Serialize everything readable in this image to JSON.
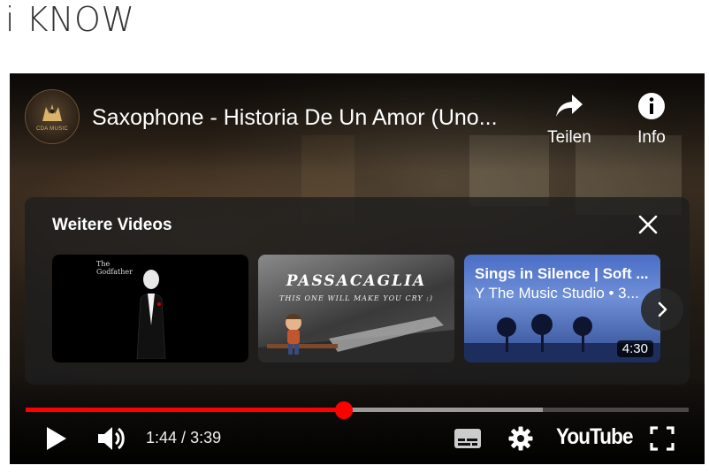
{
  "page": {
    "heading": "i KNOW"
  },
  "player": {
    "channel_logo_text": "CDA MUSIC",
    "title": "Saxophone - Historia De Un Amor (Uno...",
    "actions": [
      {
        "label": "Teilen",
        "icon": "share-icon"
      },
      {
        "label": "Info",
        "icon": "info-icon"
      }
    ],
    "more_videos": {
      "heading": "Weitere Videos",
      "items": [
        {
          "thumb_text_lines": [
            "The",
            "Godfather"
          ]
        },
        {
          "thumb_title": "PASSACAGLIA",
          "thumb_subtitle": "THIS ONE WILL MAKE YOU CRY :)"
        },
        {
          "title": "Sings in Silence | Soft ...",
          "channel_meta": "Y The Music Studio • 3...",
          "duration": "4:30"
        }
      ]
    },
    "progress": {
      "played_fraction": 0.48,
      "buffered_fraction": 0.78
    },
    "time": {
      "current": "1:44",
      "separator": " / ",
      "total": "3:39"
    },
    "brand": "YouTube",
    "colors": {
      "progress": "#ff0000",
      "panel": "#1e1e1e"
    }
  }
}
